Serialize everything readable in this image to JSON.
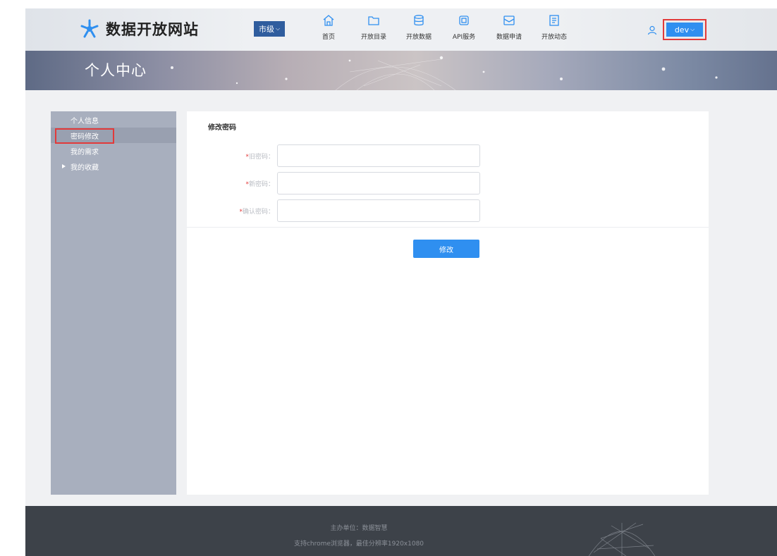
{
  "header": {
    "site_title": "数据开放网站",
    "city_select": "市级",
    "nav": [
      {
        "label": "首页",
        "icon": "home-icon"
      },
      {
        "label": "开放目录",
        "icon": "folder-icon"
      },
      {
        "label": "开放数据",
        "icon": "database-icon"
      },
      {
        "label": "API服务",
        "icon": "api-icon"
      },
      {
        "label": "数据申请",
        "icon": "mail-icon"
      },
      {
        "label": "开放动态",
        "icon": "document-icon"
      }
    ],
    "user": "dev"
  },
  "banner": {
    "title": "个人中心"
  },
  "sidebar": {
    "items": [
      {
        "label": "个人信息",
        "active": false
      },
      {
        "label": "密码修改",
        "active": true
      },
      {
        "label": "我的需求",
        "active": false
      },
      {
        "label": "我的收藏",
        "active": false,
        "expandable": true
      }
    ]
  },
  "form": {
    "title": "修改密码",
    "fields": [
      {
        "label": "旧密码：",
        "value": ""
      },
      {
        "label": "新密码：",
        "value": ""
      },
      {
        "label": "确认密码：",
        "value": ""
      }
    ],
    "submit_label": "修改"
  },
  "footer": {
    "line1": "主办单位：数据智慧",
    "line2": "支持chrome浏览器，最佳分辨率1920x1080"
  },
  "colors": {
    "accent": "#2f8ff0",
    "highlight_box": "#e23a3a",
    "sidebar_bg": "#a8afbe",
    "footer_bg": "#3d4249"
  }
}
